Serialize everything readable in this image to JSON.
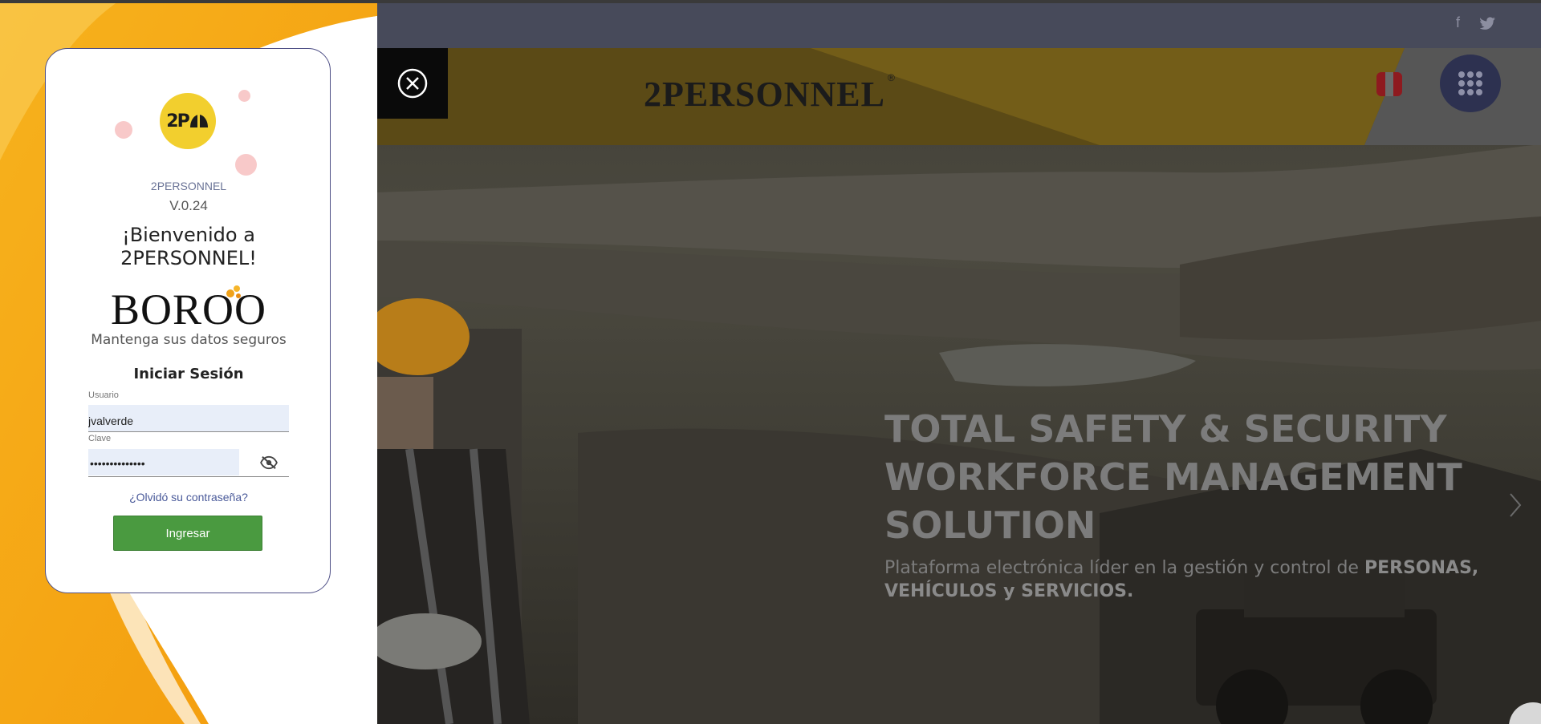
{
  "login": {
    "app_name": "2PERSONNEL",
    "version": "V.0.24",
    "welcome": "¡Bienvenido a 2PERSONNEL!",
    "brand": "BOROO",
    "tagline": "Mantenga sus datos seguros",
    "title": "Iniciar Sesión",
    "username_label": "Usuario",
    "username_value": "jvalverde",
    "password_label": "Clave",
    "password_value": "••••••••••••••",
    "forgot_link": "¿Olvidó su contraseña?",
    "submit_label": "Ingresar",
    "logo_text": "2P"
  },
  "site": {
    "header_logo": "2PERSONNEL",
    "registered_mark": "®",
    "social": [
      "f",
      "t"
    ],
    "headline_lines": [
      "TOTAL SAFETY & SECURITY",
      "WORKFORCE MANAGEMENT",
      "SOLUTION"
    ],
    "subline_prefix": "Plataforma electrónica líder en la gestión y control de",
    "subline_bold": "PERSONAS, VEHÍCULOS y SERVICIOS."
  },
  "colors": {
    "accent_orange": "#f5a10f",
    "header_gold": "#b08a1c",
    "login_button": "#4a9a40",
    "logo_yellow": "#f2cf2e",
    "flag_red": "#c8102e"
  },
  "icons": [
    "close-circle-icon",
    "grid-menu-icon",
    "eye-off-icon",
    "facebook-icon",
    "twitter-icon",
    "chevron-right-icon"
  ]
}
